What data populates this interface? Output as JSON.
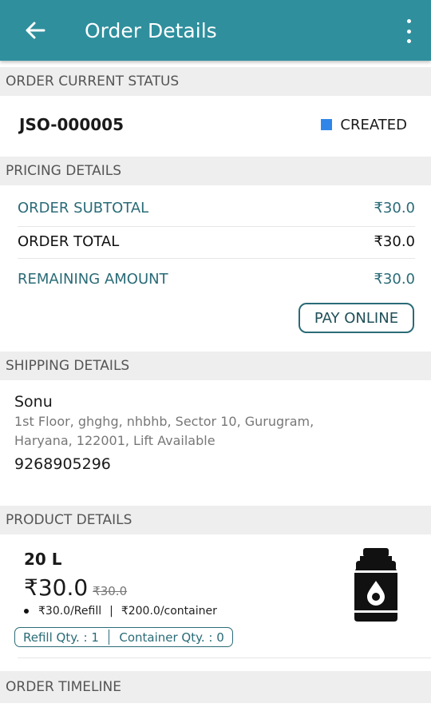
{
  "app_bar": {
    "title": "Order Details",
    "color": "#2f8f9d"
  },
  "status_section": {
    "header": "ORDER CURRENT STATUS",
    "order_id": "JSO-000005",
    "status": "CREATED",
    "status_color": "#2f86e8"
  },
  "pricing_section": {
    "header": "PRICING DETAILS",
    "subtotal_label": "ORDER SUBTOTAL",
    "subtotal_value": "₹30.0",
    "total_label": "ORDER TOTAL",
    "total_value": "₹30.0",
    "remaining_label": "REMAINING AMOUNT",
    "remaining_value": "₹30.0",
    "pay_button": "PAY ONLINE"
  },
  "shipping_section": {
    "header": "SHIPPING DETAILS",
    "name": "Sonu",
    "address_line1": "1st Floor, ghghg, nhbhb, Sector 10, Gurugram,",
    "address_line2": "Haryana, 122001, Lift Available",
    "phone": "9268905296"
  },
  "product_section": {
    "header": "PRODUCT DETAILS",
    "size": "20 L",
    "price": "₹30.0",
    "original_price": "₹30.0",
    "refill_rate": "₹30.0/Refill",
    "separator": "|",
    "container_rate": "₹200.0/container",
    "refill_qty": "Refill Qty. : 1",
    "container_qty": "Container Qty. : 0",
    "icon": "water-bottle-icon"
  },
  "timeline_section": {
    "header": "ORDER TIMELINE"
  }
}
